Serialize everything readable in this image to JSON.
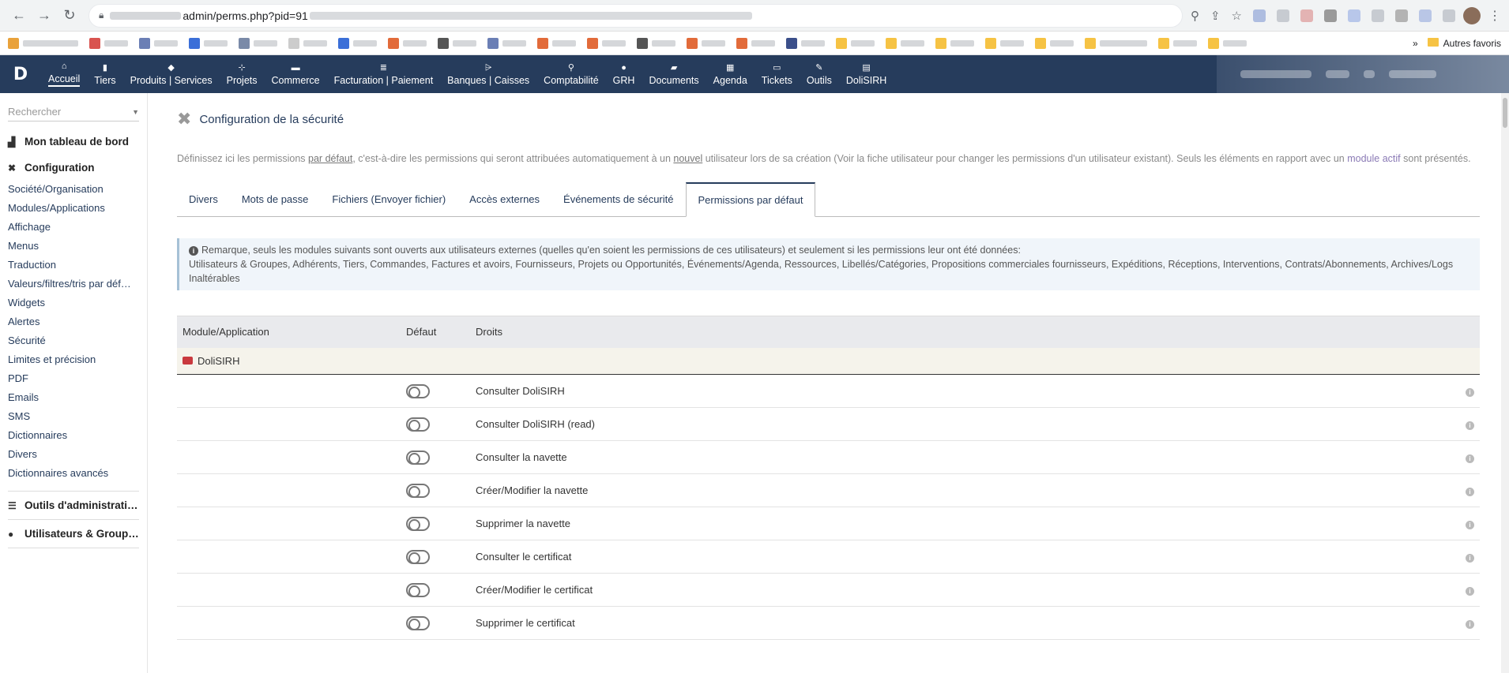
{
  "browser": {
    "url_visible": "admin/perms.php?pid=91",
    "bookmarks_right_label": "Autres favoris"
  },
  "topmenu": [
    {
      "label": "Accueil",
      "icon": "home-icon",
      "glyph": "⌂",
      "active": true
    },
    {
      "label": "Tiers",
      "icon": "building-icon",
      "glyph": "▮"
    },
    {
      "label": "Produits | Services",
      "icon": "cube-icon",
      "glyph": "◆"
    },
    {
      "label": "Projets",
      "icon": "sitemap-icon",
      "glyph": "⊹"
    },
    {
      "label": "Commerce",
      "icon": "briefcase-icon",
      "glyph": "▬"
    },
    {
      "label": "Facturation | Paiement",
      "icon": "money-icon",
      "glyph": "≣"
    },
    {
      "label": "Banques | Caisses",
      "icon": "bank-icon",
      "glyph": "⩥"
    },
    {
      "label": "Comptabilité",
      "icon": "search-dollar-icon",
      "glyph": "⚲"
    },
    {
      "label": "GRH",
      "icon": "user-icon",
      "glyph": "●"
    },
    {
      "label": "Documents",
      "icon": "folder-icon",
      "glyph": "▰"
    },
    {
      "label": "Agenda",
      "icon": "calendar-icon",
      "glyph": "▦"
    },
    {
      "label": "Tickets",
      "icon": "ticket-icon",
      "glyph": "▭"
    },
    {
      "label": "Outils",
      "icon": "wrench-icon",
      "glyph": "✎"
    },
    {
      "label": "DoliSIRH",
      "icon": "id-card-icon",
      "glyph": "▤"
    }
  ],
  "sidebar": {
    "search_placeholder": "Rechercher",
    "dashboard": "Mon tableau de bord",
    "config_title": "Configuration",
    "config_items": [
      "Société/Organisation",
      "Modules/Applications",
      "Affichage",
      "Menus",
      "Traduction",
      "Valeurs/filtres/tris par déf…",
      "Widgets",
      "Alertes",
      "Sécurité",
      "Limites et précision",
      "PDF",
      "Emails",
      "SMS",
      "Dictionnaires",
      "Divers",
      "Dictionnaires avancés"
    ],
    "admin_tools": "Outils d'administrati…",
    "users_groups": "Utilisateurs & Group…"
  },
  "page": {
    "title": "Configuration de la sécurité",
    "intro_1": "Définissez ici les permissions ",
    "intro_par_defaut": "par défaut",
    "intro_2": ", c'est-à-dire les permissions qui seront attribuées automatiquement à un ",
    "intro_nouvel": "nouvel",
    "intro_3": " utilisateur lors de sa création (Voir la fiche utilisateur pour changer les permissions d'un utilisateur existant). Seuls les éléments en rapport avec un ",
    "intro_module_actif": "module actif",
    "intro_4": " sont présentés.",
    "tabs": [
      {
        "label": "Divers"
      },
      {
        "label": "Mots de passe"
      },
      {
        "label": "Fichiers (Envoyer fichier)"
      },
      {
        "label": "Accès externes"
      },
      {
        "label": "Événements de sécurité"
      },
      {
        "label": "Permissions par défaut",
        "active": true
      }
    ],
    "note_first": "Remarque, seuls les modules suivants sont ouverts aux utilisateurs externes (quelles qu'en soient les permissions de ces utilisateurs) et seulement si les permissions leur ont été données:",
    "note_second": "Utilisateurs & Groupes, Adhérents, Tiers, Commandes, Factures et avoirs, Fournisseurs, Projets ou Opportunités, Événements/Agenda, Ressources, Libellés/Catégories, Propositions commerciales fournisseurs, Expéditions, Réceptions, Interventions, Contrats/Abonnements, Archives/Logs Inaltérables"
  },
  "table": {
    "headers": [
      "Module/Application",
      "Défaut",
      "Droits"
    ],
    "module": "DoliSIRH",
    "rights": [
      "Consulter DoliSIRH",
      "Consulter DoliSIRH (read)",
      "Consulter la navette",
      "Créer/Modifier la navette",
      "Supprimer la navette",
      "Consulter le certificat",
      "Créer/Modifier le certificat",
      "Supprimer le certificat"
    ]
  },
  "colors": {
    "topbar": "#263c5c",
    "link": "#263c5c",
    "module_row": "#f5f3eb"
  }
}
